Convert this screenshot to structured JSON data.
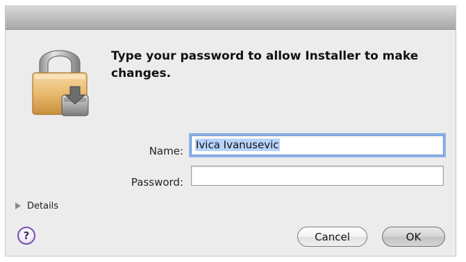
{
  "dialog": {
    "message": "Type your password to allow Installer to make changes.",
    "icon": "lock-installer-icon"
  },
  "form": {
    "name_label": "Name:",
    "name_value": "Ivica Ivanusevic",
    "password_label": "Password:",
    "password_value": ""
  },
  "details": {
    "label": "Details",
    "icon": "disclosure-triangle-icon"
  },
  "buttons": {
    "help_label": "?",
    "cancel_label": "Cancel",
    "ok_label": "OK"
  },
  "colors": {
    "focus_ring": "#8db3e8",
    "help_border": "#7a4fb0",
    "window_bg": "#ececec"
  }
}
